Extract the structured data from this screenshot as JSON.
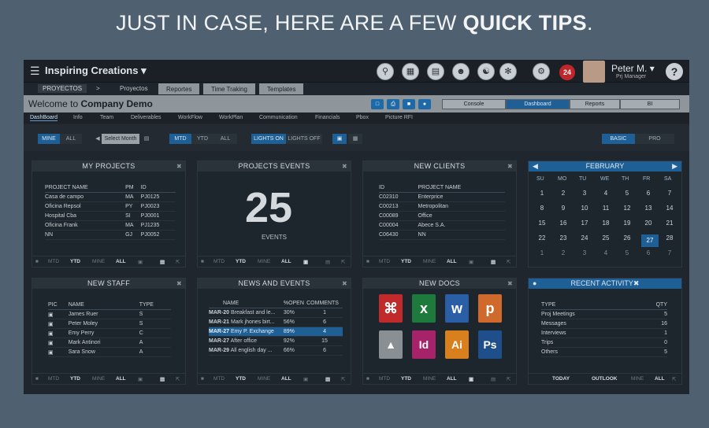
{
  "headline": {
    "prefix": "JUST IN CASE, HERE ARE A FEW ",
    "bold": "QUICK TIPS",
    "suffix": "."
  },
  "topbar": {
    "brand": "Inspiring Creations",
    "icons": [
      "search-icon",
      "org-chart-icon",
      "calendar-icon",
      "people-icon",
      "team-icon",
      "network-icon",
      "settings-icon"
    ],
    "badge_count": "24",
    "user_name": "Peter M.",
    "user_role": "Prj Manager",
    "help_label": "?"
  },
  "crumbs": {
    "root": "PROYECTOS",
    "sep": ">",
    "tabs": [
      "Proyectos",
      "Reportes",
      "Time Traking",
      "Templates"
    ]
  },
  "welcome": {
    "prefix": "Welcome to ",
    "company": "Company Demo",
    "views": [
      "Console",
      "Dashboard",
      "Reports",
      "BI"
    ]
  },
  "subnav": [
    "DashBoard",
    "Info",
    "Team",
    "Deliverables",
    "WorkFlow",
    "WorkPlan",
    "Communication",
    "Financials",
    "Pbox",
    "Picture RFI"
  ],
  "filter": {
    "mine": "MINE",
    "all": "ALL",
    "month": "Select Month",
    "mtd": "MTD",
    "ytd": "YTD",
    "all2": "ALL",
    "lights_on": "LIGHTS ON",
    "lights_off": "LIGHTS OFF",
    "basic": "BASIC",
    "pro": "PRO"
  },
  "footer_labels": {
    "mtd": "MTD",
    "ytd": "YTD",
    "mine": "MINE",
    "all": "ALL",
    "today": "TODAY",
    "outlook": "OUTLOOK"
  },
  "my_projects": {
    "title": "MY PROJECTS",
    "columns": [
      "PROJECT NAME",
      "PM",
      "ID"
    ],
    "rows": [
      [
        "Casa de campo",
        "MA",
        "PJ0125"
      ],
      [
        "Oficina Repsol",
        "PY",
        "PJ0023"
      ],
      [
        "Hospital Cba",
        "SI",
        "PJ0001"
      ],
      [
        "Oficina Frank",
        "MA",
        "PJ1235"
      ],
      [
        "NN",
        "GJ",
        "PJ0052"
      ]
    ]
  },
  "projects_events": {
    "title": "PROJECTS EVENTS",
    "count": "25",
    "label": "EVENTS"
  },
  "new_clients": {
    "title": "NEW CLIENTS",
    "columns": [
      "ID",
      "PROJECT NAME"
    ],
    "rows": [
      [
        "C02310",
        "Enterprice"
      ],
      [
        "C00213",
        "Metropolitan"
      ],
      [
        "C00089",
        "Office"
      ],
      [
        "C00004",
        "Abece S.A."
      ],
      [
        "C06430",
        "NN"
      ]
    ]
  },
  "calendar": {
    "month": "FEBRUARY",
    "dow": [
      "SU",
      "MO",
      "TU",
      "WE",
      "TH",
      "FR",
      "SA"
    ],
    "weeks": [
      [
        "1",
        "2",
        "3",
        "4",
        "5",
        "6",
        "7"
      ],
      [
        "8",
        "9",
        "10",
        "11",
        "12",
        "13",
        "14"
      ],
      [
        "15",
        "16",
        "17",
        "18",
        "19",
        "20",
        "21"
      ],
      [
        "22",
        "23",
        "24",
        "25",
        "26",
        "27",
        "28"
      ],
      [
        "1",
        "2",
        "3",
        "4",
        "5",
        "6",
        "7"
      ]
    ],
    "selected": "27"
  },
  "new_staff": {
    "title": "NEW STAFF",
    "columns": [
      "PIC",
      "NAME",
      "TYPE"
    ],
    "rows": [
      [
        "James Ruer",
        "S"
      ],
      [
        "Peter Moley",
        "S"
      ],
      [
        "Emy Perry",
        "C"
      ],
      [
        "Mark Antinori",
        "A"
      ],
      [
        "Sara Snow",
        "A"
      ]
    ]
  },
  "news_events": {
    "title": "NEWS AND EVENTS",
    "columns": [
      "NAME",
      "%OPEN",
      "COMMENTS"
    ],
    "rows": [
      [
        "MAR-20",
        "Breakfast and le...",
        "30%",
        "1"
      ],
      [
        "MAR-21",
        "Mark jhones birt...",
        "56%",
        "6"
      ],
      [
        "MAR-27",
        "Emy P. Exchange",
        "89%",
        "4"
      ],
      [
        "MAR-27",
        "After office",
        "92%",
        "15"
      ],
      [
        "MAR-29",
        "All english day ...",
        "66%",
        "6"
      ]
    ]
  },
  "new_docs": {
    "title": "NEW DOCS",
    "docs": [
      {
        "label": "⌘",
        "color": "#c12a2a",
        "icon": "pdf-icon"
      },
      {
        "label": "x",
        "color": "#1e7a3c",
        "icon": "excel-icon"
      },
      {
        "label": "w",
        "color": "#2a5fa8",
        "icon": "word-icon"
      },
      {
        "label": "p",
        "color": "#d06a2c",
        "icon": "powerpoint-icon"
      },
      {
        "label": "▲",
        "color": "#8a8f93",
        "icon": "image-icon"
      },
      {
        "label": "Id",
        "color": "#a6236a",
        "icon": "indesign-icon"
      },
      {
        "label": "Ai",
        "color": "#d9801e",
        "icon": "illustrator-icon"
      },
      {
        "label": "Ps",
        "color": "#1e4f8a",
        "icon": "photoshop-icon"
      }
    ]
  },
  "recent_activity": {
    "title": "RECENT ACTIVITY",
    "columns": [
      "TYPE",
      "QTY"
    ],
    "rows": [
      [
        "Proj Meetings",
        "5"
      ],
      [
        "Messages",
        "16"
      ],
      [
        "Interviews",
        "1"
      ],
      [
        "Trips",
        "0"
      ],
      [
        "Others",
        "5"
      ]
    ]
  }
}
